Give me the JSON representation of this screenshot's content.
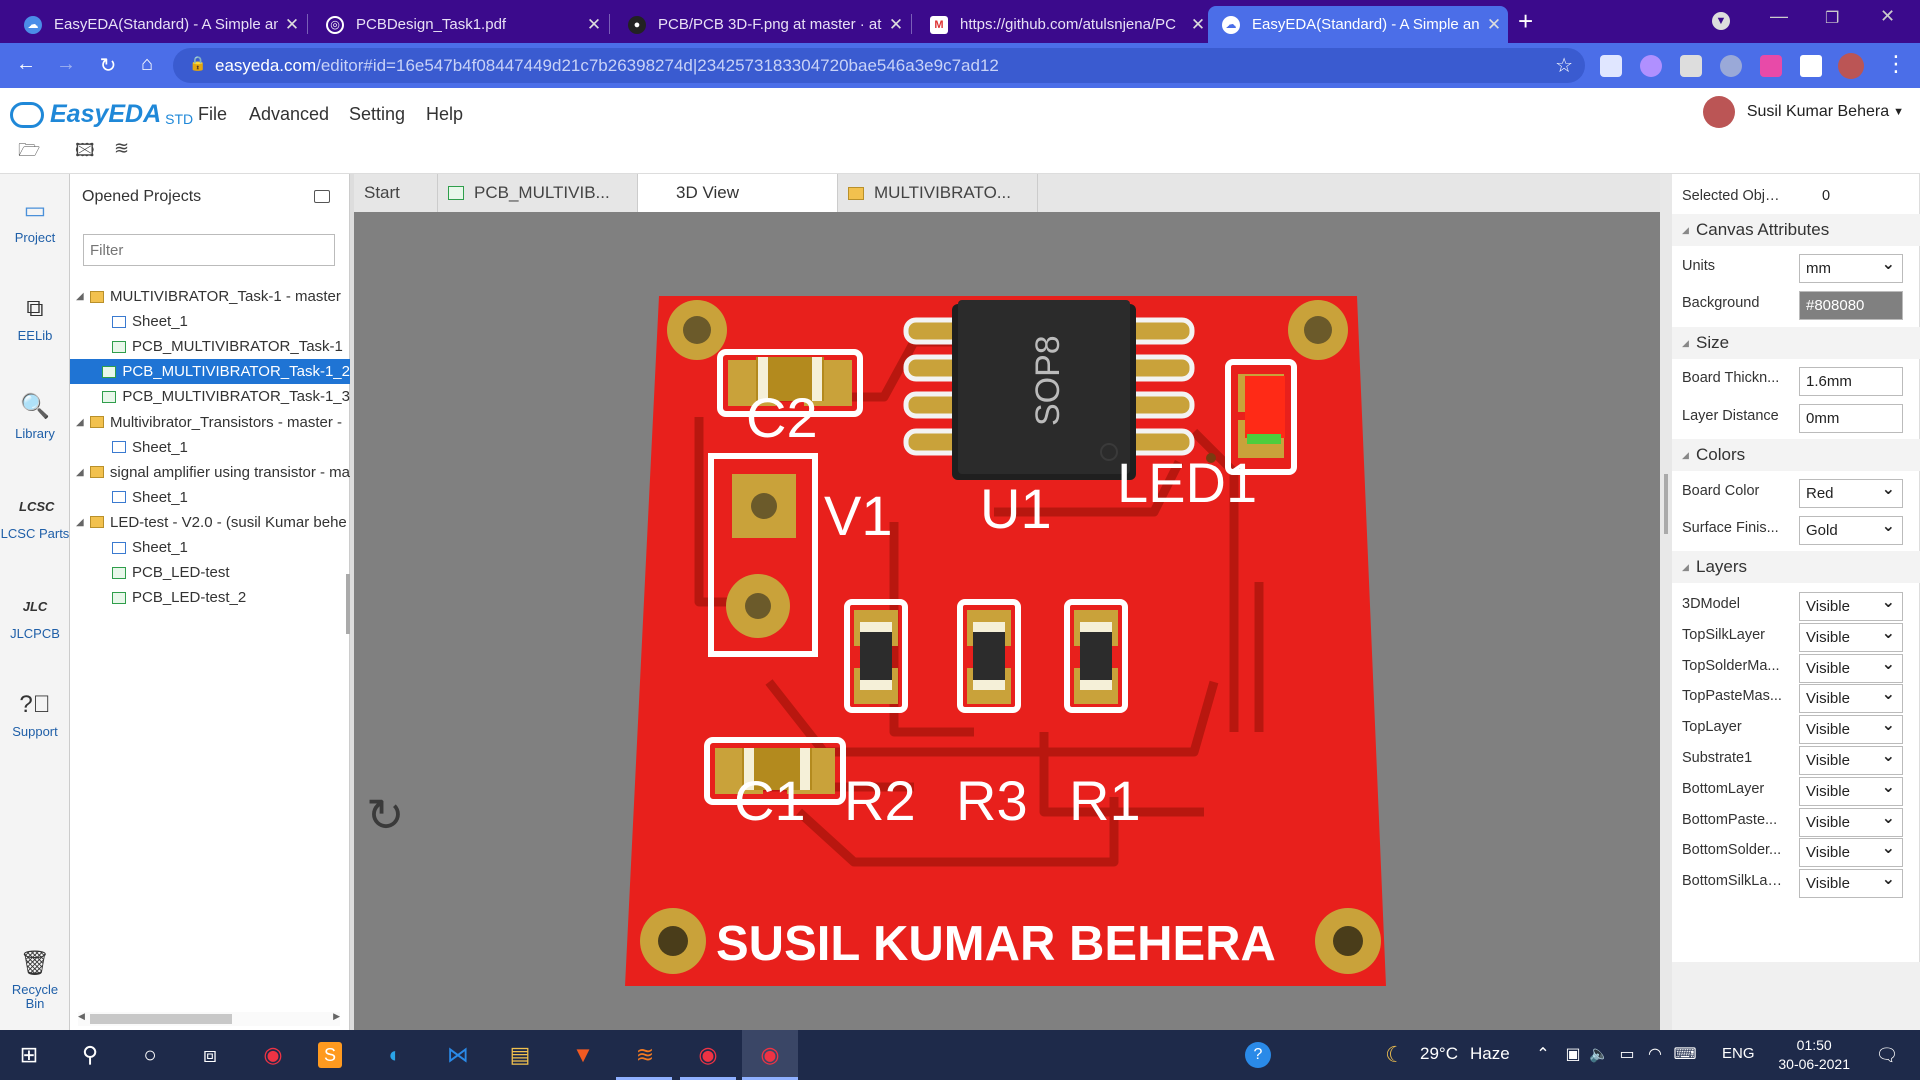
{
  "browser": {
    "tabs": [
      {
        "title": "EasyEDA(Standard) - A Simple an",
        "icon": "easyeda-icon"
      },
      {
        "title": "PCBDesign_Task1.pdf",
        "icon": "globe-icon"
      },
      {
        "title": "PCB/PCB 3D-F.png at master · atı",
        "icon": "github-icon"
      },
      {
        "title": "https://github.com/atulsnjena/PC",
        "icon": "gmail-icon"
      },
      {
        "title": "EasyEDA(Standard) - A Simple an",
        "icon": "easyeda-icon"
      }
    ],
    "url_host": "easyeda.com",
    "url_path": "/editor#id=16e547b4f08447449d21c7b26398274d|2342573183304720bae546a3e9c7ad12"
  },
  "app": {
    "logo": "EasyEDA",
    "edition": "STD",
    "menu": [
      "File",
      "Advanced",
      "Setting",
      "Help"
    ],
    "user": "Susil Kumar Behera"
  },
  "sidebar": {
    "items": [
      {
        "label": "Project",
        "icon": "project-icon"
      },
      {
        "label": "EELib",
        "icon": "eelib-icon"
      },
      {
        "label": "Library",
        "icon": "library-icon"
      },
      {
        "label": "LCSC Parts",
        "icon": "lcsc-icon"
      },
      {
        "label": "JLCPCB",
        "icon": "jlcpcb-icon"
      },
      {
        "label": "Support",
        "icon": "support-icon"
      },
      {
        "label": "Recycle Bin",
        "icon": "recycle-bin-icon"
      }
    ]
  },
  "projects": {
    "title": "Opened Projects",
    "filter_placeholder": "Filter",
    "tree": [
      {
        "label": "MULTIVIBRATOR_Task-1 - master",
        "type": "folder",
        "level": 0
      },
      {
        "label": "Sheet_1",
        "type": "sch",
        "level": 1
      },
      {
        "label": "PCB_MULTIVIBRATOR_Task-1",
        "type": "pcb",
        "level": 1
      },
      {
        "label": "PCB_MULTIVIBRATOR_Task-1_2",
        "type": "pcb",
        "level": 1,
        "selected": true
      },
      {
        "label": "PCB_MULTIVIBRATOR_Task-1_3",
        "type": "pcb",
        "level": 1
      },
      {
        "label": "Multivibrator_Transistors - master - ",
        "type": "folder",
        "level": 0
      },
      {
        "label": "Sheet_1",
        "type": "sch",
        "level": 1
      },
      {
        "label": "signal amplifier using transistor - ma",
        "type": "folder",
        "level": 0
      },
      {
        "label": "Sheet_1",
        "type": "sch",
        "level": 1
      },
      {
        "label": "LED-test - V2.0 - (susil Kumar behe",
        "type": "folder",
        "level": 0
      },
      {
        "label": "Sheet_1",
        "type": "sch",
        "level": 1
      },
      {
        "label": "PCB_LED-test",
        "type": "pcb",
        "level": 1
      },
      {
        "label": "PCB_LED-test_2",
        "type": "pcb",
        "level": 1
      }
    ]
  },
  "doc_tabs": [
    {
      "label": "Start",
      "icon": ""
    },
    {
      "label": "PCB_MULTIVIB...",
      "icon": "pcb-icon"
    },
    {
      "label": "3D View",
      "icon": "",
      "active": true
    },
    {
      "label": "MULTIVIBRATO...",
      "icon": "folder-icon"
    }
  ],
  "board": {
    "silk": {
      "c2": "C2",
      "v1": "V1",
      "u1": "U1",
      "led1": "LED1",
      "c1": "C1",
      "r2": "R2",
      "r3": "R3",
      "r1": "R1",
      "ic_marking": "SOP8",
      "name": "SUSIL KUMAR BEHERA"
    },
    "board_color": "#e8201c",
    "pad_color": "#c9a23a"
  },
  "properties": {
    "selected_label": "Selected Objects",
    "selected_count": "0",
    "canvas_attributes": "Canvas Attributes",
    "units_label": "Units",
    "units_value": "mm",
    "background_label": "Background",
    "background_value": "#808080",
    "size_title": "Size",
    "thickness_label": "Board Thickn...",
    "thickness_value": "1.6mm",
    "layer_distance_label": "Layer Distance",
    "layer_distance_value": "0mm",
    "colors_title": "Colors",
    "board_color_label": "Board Color",
    "board_color_value": "Red",
    "surface_label": "Surface Finis...",
    "surface_value": "Gold",
    "layers_title": "Layers",
    "layers": [
      {
        "name": "3DModel",
        "value": "Visible"
      },
      {
        "name": "TopSilkLayer",
        "value": "Visible"
      },
      {
        "name": "TopSolderMa...",
        "value": "Visible"
      },
      {
        "name": "TopPasteMas...",
        "value": "Visible"
      },
      {
        "name": "TopLayer",
        "value": "Visible"
      },
      {
        "name": "Substrate1",
        "value": "Visible"
      },
      {
        "name": "BottomLayer",
        "value": "Visible"
      },
      {
        "name": "BottomPaste...",
        "value": "Visible"
      },
      {
        "name": "BottomSolder...",
        "value": "Visible"
      },
      {
        "name": "BottomSilkLayer",
        "value": "Visible"
      }
    ]
  },
  "taskbar": {
    "weather_temp": "29°C",
    "weather_text": "Haze",
    "lang": "ENG",
    "time": "01:50",
    "date": "30-06-2021"
  }
}
